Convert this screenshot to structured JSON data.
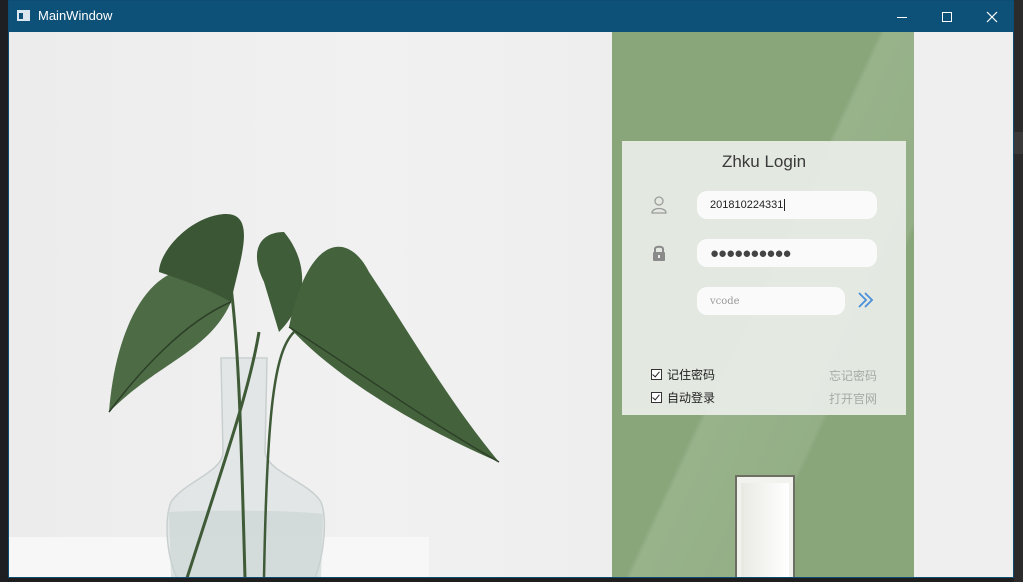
{
  "window": {
    "title": "MainWindow",
    "icons": {
      "app": "app-window-icon",
      "minimize": "minimize-icon",
      "maximize": "maximize-icon",
      "close": "close-icon"
    },
    "colors": {
      "titlebar": "#0d5078",
      "wall": "#89a57a",
      "accent_arrow": "#4a90d9"
    }
  },
  "login": {
    "heading": "Zhku Login",
    "username": {
      "icon": "user-icon",
      "value": "201810224331"
    },
    "password": {
      "icon": "lock-icon",
      "masked_value": "●●●●●●●●●●"
    },
    "vcode": {
      "placeholder": "vcode",
      "submit_icon": "double-chevron-right-icon"
    },
    "remember_password": {
      "label": "记住密码",
      "checked": true
    },
    "auto_login": {
      "label": "自动登录",
      "checked": true
    },
    "forgot_password_link": "忘记密码",
    "open_website_link": "打开官网"
  },
  "background": {
    "left_image": "plant-in-vase-image",
    "right_image": "green-wall-door-image"
  }
}
